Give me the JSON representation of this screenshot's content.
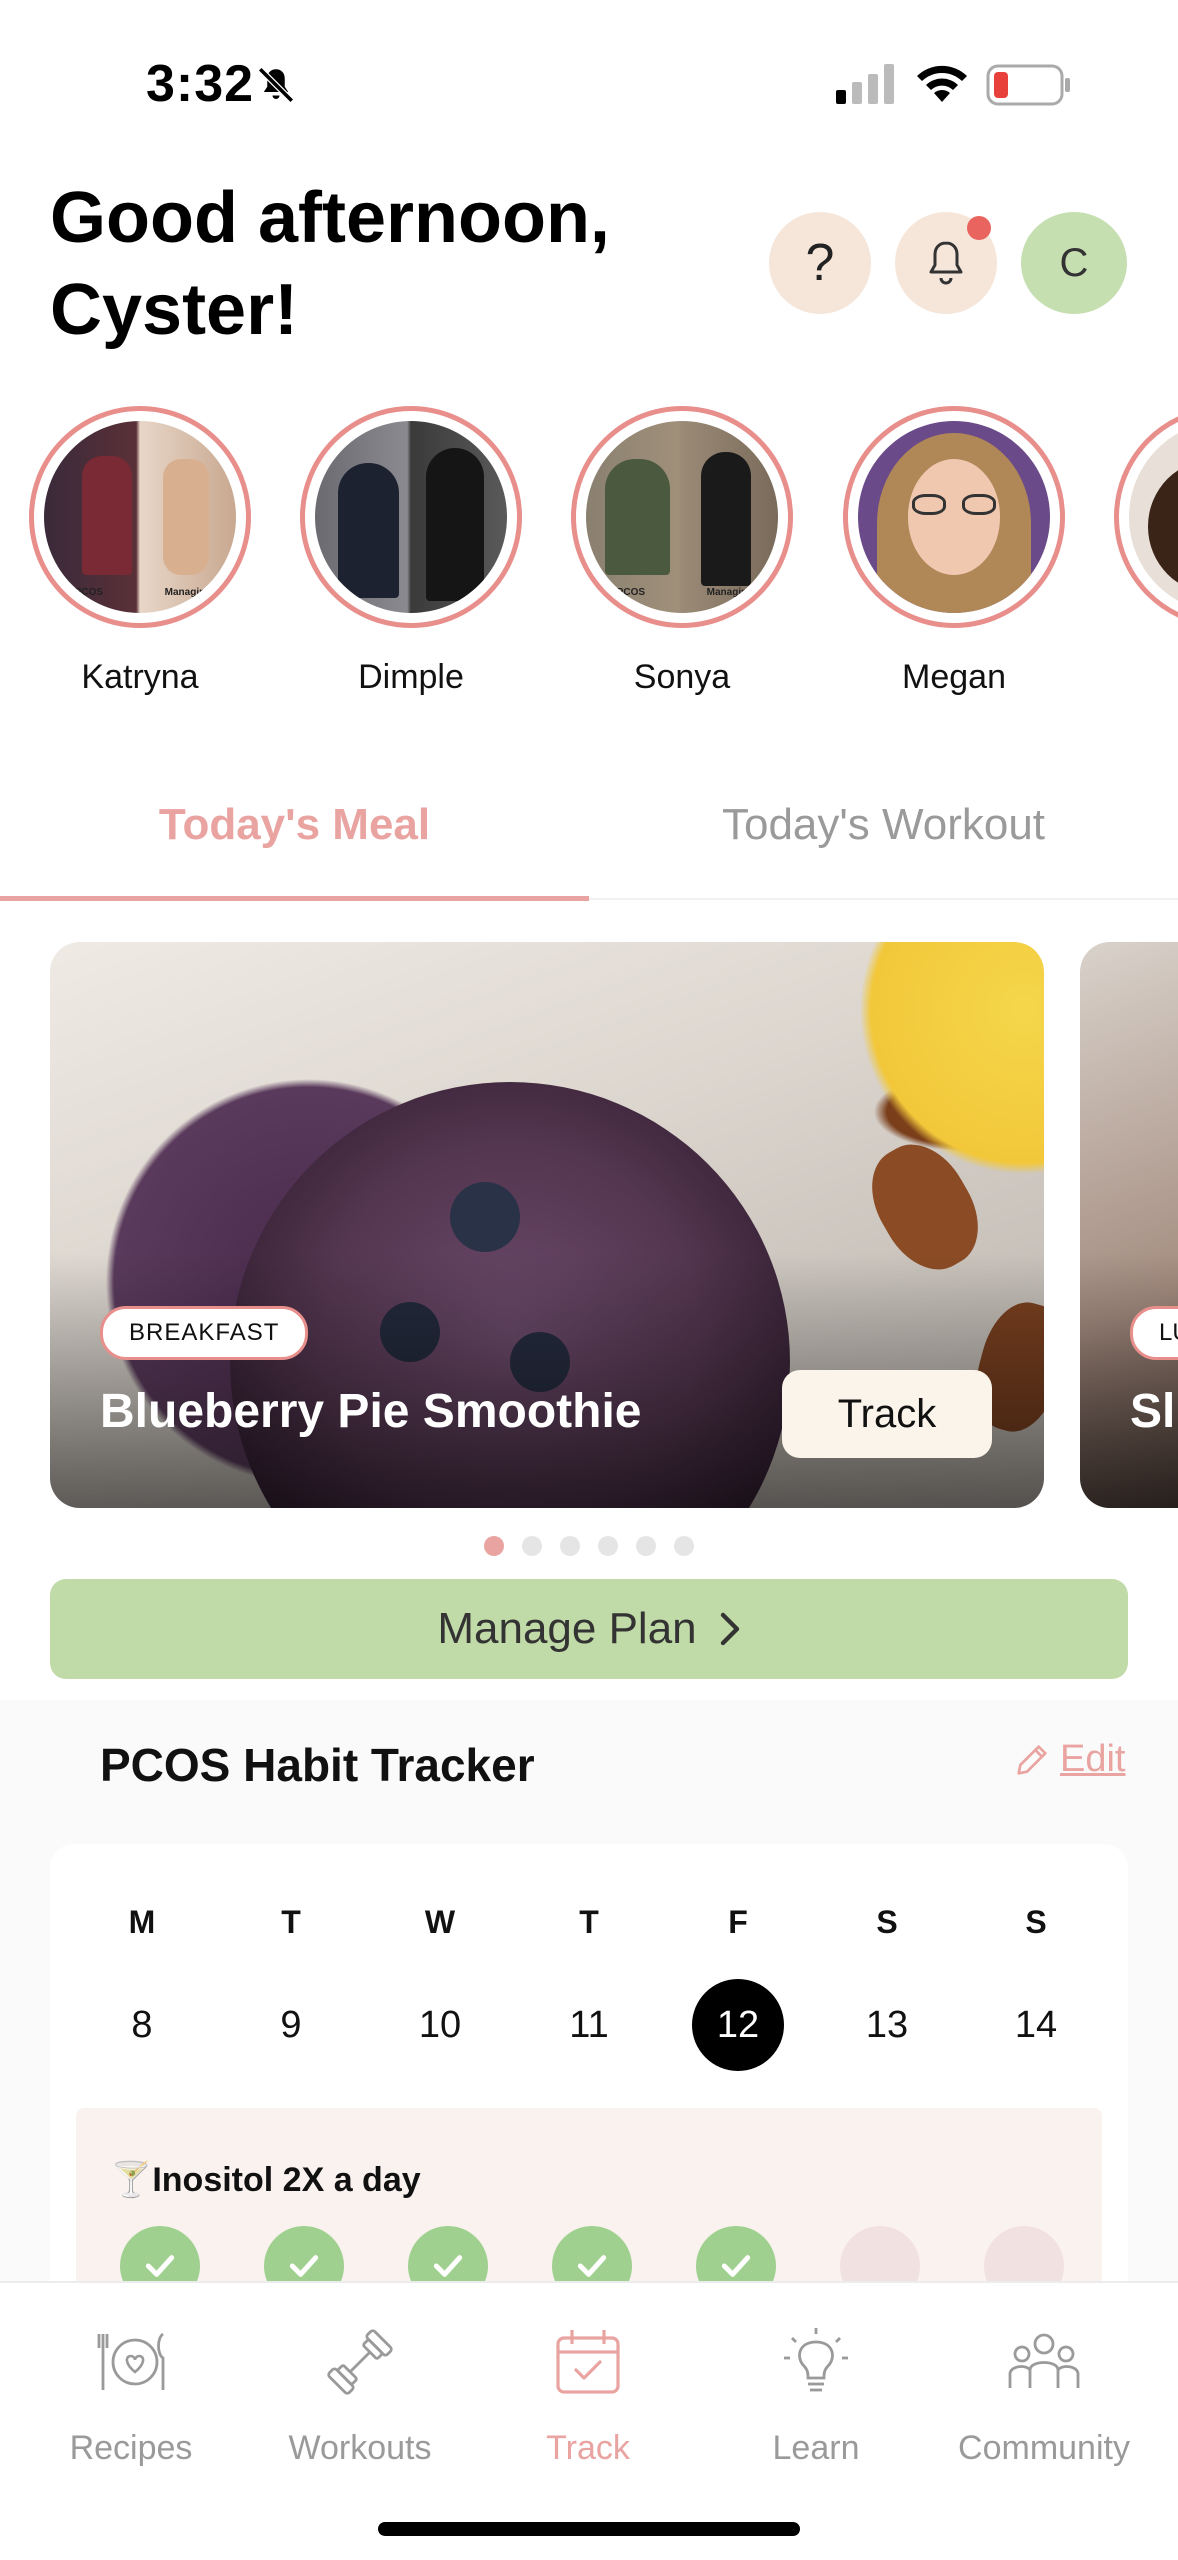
{
  "status_bar": {
    "time": "3:32"
  },
  "header": {
    "greeting": "Good afternoon, Cyster!",
    "help_symbol": "?",
    "avatar_initial": "C"
  },
  "stories": [
    {
      "name": "Katryna",
      "photo_label_left": "PCOS",
      "photo_label_right": "Managin"
    },
    {
      "name": "Dimple"
    },
    {
      "name": "Sonya",
      "photo_label_left": "PCOS",
      "photo_label_right": "Managin"
    },
    {
      "name": "Megan"
    },
    {
      "name": ""
    }
  ],
  "tabs": [
    {
      "label": "Today's Meal",
      "active": true
    },
    {
      "label": "Today's Workout",
      "active": false
    }
  ],
  "meals": [
    {
      "tag": "BREAKFAST",
      "title": "Blueberry Pie Smoothie",
      "track_label": "Track"
    },
    {
      "tag": "LU",
      "title": "Sl"
    }
  ],
  "carousel": {
    "count": 6,
    "active_index": 0
  },
  "manage_plan_label": "Manage Plan",
  "habit_tracker": {
    "title": "PCOS Habit Tracker",
    "edit_label": "Edit",
    "days": [
      {
        "letter": "M",
        "num": "8"
      },
      {
        "letter": "T",
        "num": "9"
      },
      {
        "letter": "W",
        "num": "10"
      },
      {
        "letter": "T",
        "num": "11"
      },
      {
        "letter": "F",
        "num": "12"
      },
      {
        "letter": "S",
        "num": "13"
      },
      {
        "letter": "S",
        "num": "14"
      }
    ],
    "selected_day": "12",
    "habits": [
      {
        "emoji": "🍸",
        "name": "Inositol 2X a day",
        "checks": [
          true,
          true,
          true,
          true,
          true,
          false,
          false
        ]
      }
    ]
  },
  "bottom_nav": [
    {
      "label": "Recipes",
      "icon": "recipes-icon"
    },
    {
      "label": "Workouts",
      "icon": "dumbbell-icon"
    },
    {
      "label": "Track",
      "icon": "calendar-check-icon",
      "active": true
    },
    {
      "label": "Learn",
      "icon": "lightbulb-icon"
    },
    {
      "label": "Community",
      "icon": "community-icon"
    }
  ],
  "colors": {
    "accent_pink": "#e9a3a0",
    "ring_pink": "#e88f8c",
    "green": "#c1dba8",
    "check_green": "#9fd08f",
    "cream": "#f6e6da"
  }
}
